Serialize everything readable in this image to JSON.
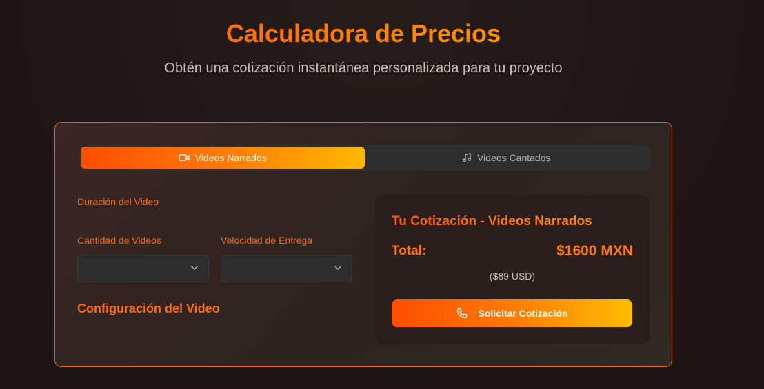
{
  "header": {
    "title": "Calculadora de Precios",
    "subtitle": "Obtén una cotización instantánea personalizada para tu proyecto"
  },
  "tabs": [
    {
      "label": "Videos Narrados",
      "icon": "video-icon",
      "active": true
    },
    {
      "label": "Videos Cantados",
      "icon": "music-note-icon",
      "active": false
    }
  ],
  "form": {
    "duration_label": "Duración del Video",
    "quantity_label": "Cantidad de Videos",
    "quantity_value": "",
    "delivery_label": "Velocidad de Entrega",
    "delivery_value": "",
    "config_heading": "Configuración del Video"
  },
  "quote": {
    "title": "Tu Cotización - Videos Narrados",
    "total_label": "Total:",
    "total_value": "$1600 MXN",
    "usd_value": "($89 USD)",
    "cta_label": "Solicitar Cotización",
    "cta_icon": "phone-icon"
  },
  "colors": {
    "accent_start": "#ff4d00",
    "accent_end": "#ffb800",
    "background": "#1e1716",
    "card_border": "#e2660f"
  }
}
